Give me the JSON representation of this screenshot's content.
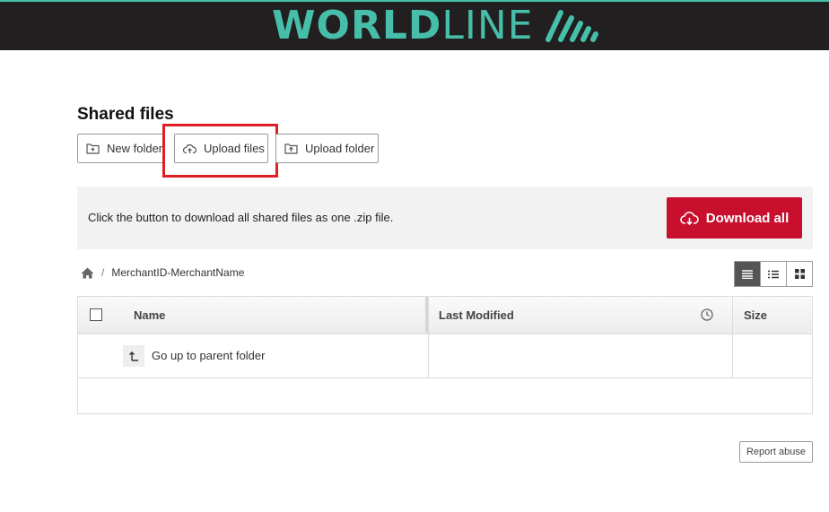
{
  "header": {
    "logo_bold": "WORLD",
    "logo_light": "LINE",
    "brand_color": "#46beaa",
    "bar_color": "#211f1f"
  },
  "page": {
    "title": "Shared files"
  },
  "toolbar": {
    "new_folder_label": "New folder",
    "upload_files_label": "Upload files",
    "upload_folder_label": "Upload folder",
    "highlight_color": "#e01e25"
  },
  "download": {
    "description": "Click the button to download all shared files as one .zip file.",
    "button_label": "Download all",
    "button_color": "#c8102e"
  },
  "breadcrumb": {
    "home_icon": "home-icon",
    "separator": "/",
    "current": "MerchantID-MerchantName"
  },
  "view_modes": [
    "details-view",
    "list-view",
    "grid-view"
  ],
  "table": {
    "columns": [
      "Name",
      "Last Modified",
      "Size"
    ],
    "rows": [
      {
        "name": "Go up to parent folder",
        "last_modified": "",
        "size": ""
      }
    ]
  },
  "footer": {
    "report_label": "Report abuse"
  }
}
